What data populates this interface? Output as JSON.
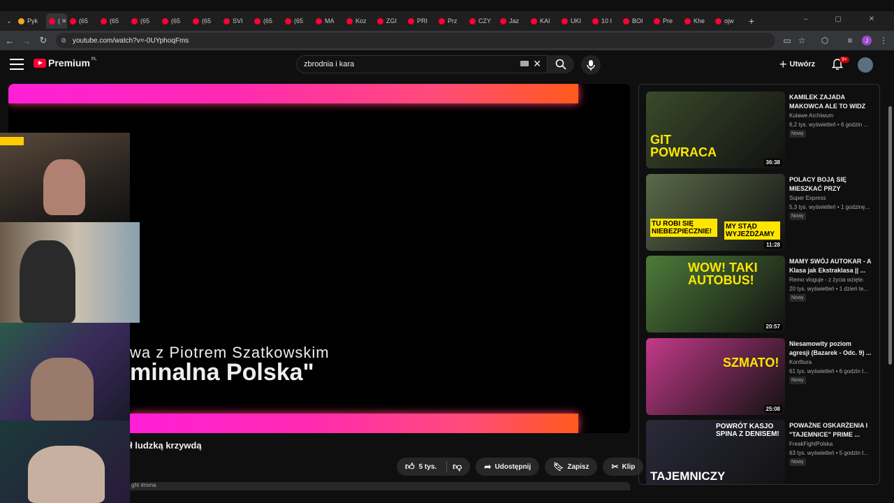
{
  "browser": {
    "tabs": [
      {
        "label": "Pyk"
      },
      {
        "label": "(",
        "active": true
      },
      {
        "label": "(65"
      },
      {
        "label": "(65"
      },
      {
        "label": "(65"
      },
      {
        "label": "(65"
      },
      {
        "label": "(65"
      },
      {
        "label": "SVI"
      },
      {
        "label": "(65"
      },
      {
        "label": "(65"
      },
      {
        "label": "MA"
      },
      {
        "label": "Koz"
      },
      {
        "label": "ZGI"
      },
      {
        "label": "PRI"
      },
      {
        "label": "Prz"
      },
      {
        "label": "CZY"
      },
      {
        "label": "Jaz"
      },
      {
        "label": "KAI"
      },
      {
        "label": "UKI"
      },
      {
        "label": "10 I"
      },
      {
        "label": "BOI"
      },
      {
        "label": "Pre"
      },
      {
        "label": "Khe"
      },
      {
        "label": "ojw"
      }
    ],
    "url": "youtube.com/watch?v=-0UYphoqFms"
  },
  "youtube": {
    "logo_text": "Premium",
    "logo_region": "PL",
    "search_value": "zbrodnia i kara",
    "create_label": "Utwórz",
    "notif_count": "9+"
  },
  "video": {
    "overlay_line1": "wa z Piotrem Szatkowskim",
    "overlay_line2": "minalna Polska\"",
    "title": "ł ludzką krzywdą",
    "likes": "5 tys.",
    "share_label": "Udostępnij",
    "save_label": "Zapisz",
    "clip_label": "Klip",
    "desc_snippet": "ght #mma"
  },
  "recommendations": [
    {
      "title": "KAMILEK ZAJADA MAKOWCA ALE TO WIDZ ...",
      "channel": "Kulawe Archiwum",
      "meta": "6,2 tys. wyświetleń • 6 godzin ...",
      "badge": "Nowy",
      "duration": "36:38",
      "thumb_text": "GIT POWRACA",
      "thumb_color": "#3a4a2a",
      "text_color": "#ffe600"
    },
    {
      "title": "POLACY BOJĄ SIĘ MIESZKAĆ PRZY GRANIC...",
      "channel": "Super Express",
      "meta": "5,3 tys. wyświetleń • 1 godzinę...",
      "badge": "Nowy",
      "duration": "11:28",
      "thumb_text": "TU ROBI SIĘ NIEBEZPIECZNIE!",
      "thumb_text2": "MY STĄD WYJEŻDŻAMY",
      "thumb_color": "#5b6b4a",
      "text_color": "#000"
    },
    {
      "title": "MAMY SWÓJ AUTOKAR - A Klasa jak Ekstraklasa || ...",
      "channel": "Remo vloguje - z życia wzięte.",
      "meta": "20 tys. wyświetleń • 1 dzień te...",
      "badge": "Nowy",
      "duration": "20:57",
      "thumb_text": "WOW! TAKI AUTOBUS!",
      "thumb_color": "#4d7c3a",
      "text_color": "#ffe600"
    },
    {
      "title": "Niesamowity poziom agresji (Bazarek - Odc. 9) ...",
      "channel": "Konfitura",
      "meta": "61 tys. wyświetleń • 6 godzin t...",
      "badge": "Nowy",
      "duration": "25:08",
      "thumb_text": "SZMATO!",
      "thumb_color": "#c23a8a",
      "text_color": "#ffe600"
    },
    {
      "title": "POWAŻNE OSKARŻENIA I \"TAJEMNICE\" PRIME ...",
      "channel": "FreakFightPolska",
      "meta": "63 tys. wyświetleń • 5 godzin t...",
      "badge": "Nowy",
      "duration": "",
      "thumb_text": "TAJEMNICZY",
      "thumb_text2": "POWRÓT KASJO SPINA Z DENISEM!",
      "thumb_color": "#2a2a3a",
      "text_color": "#fff"
    }
  ]
}
